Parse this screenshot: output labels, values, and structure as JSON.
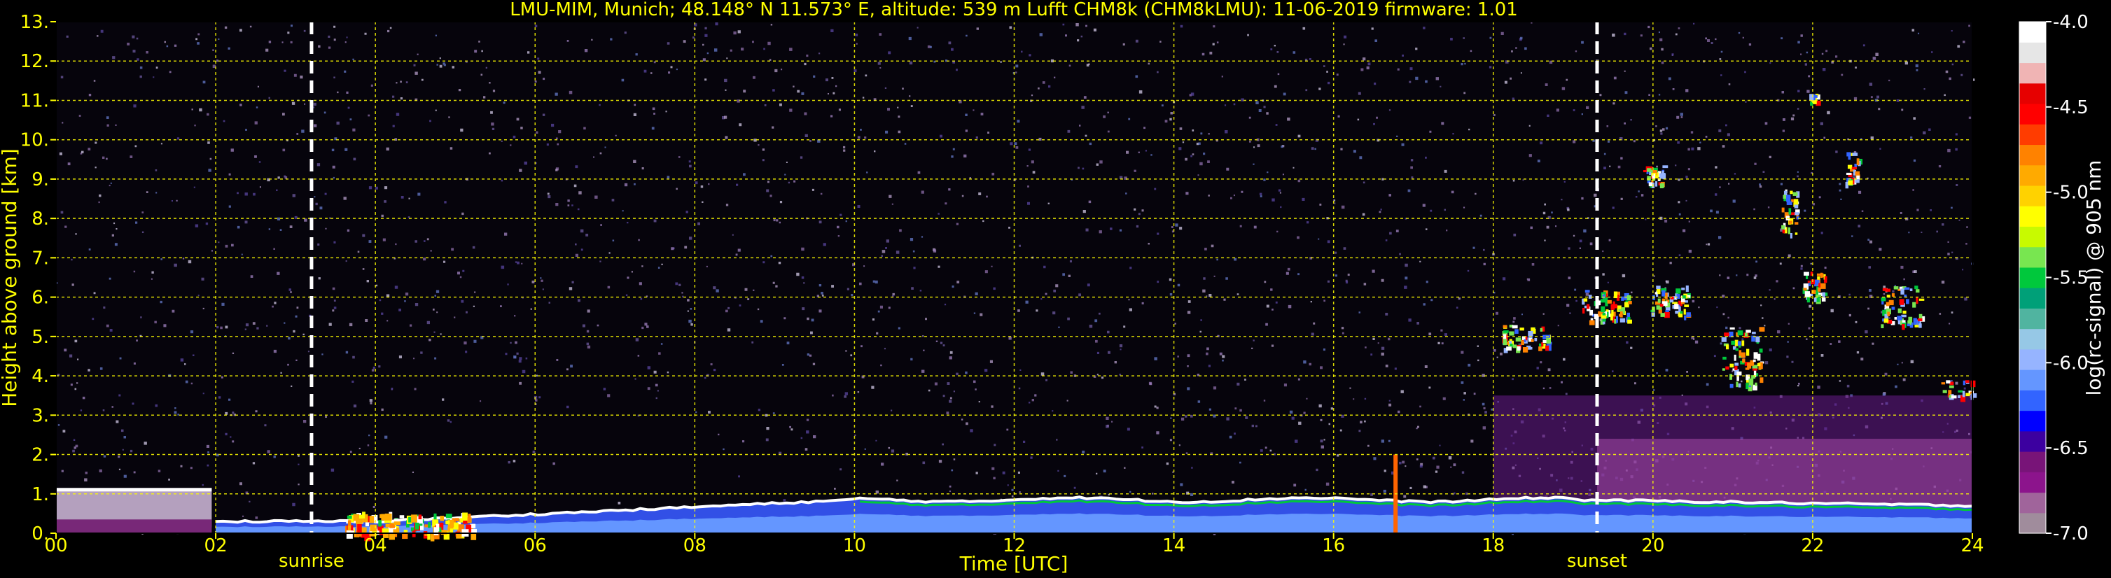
{
  "chart_data": {
    "type": "heatmap",
    "title": "LMU-MIM, Munich; 48.148° N 11.573° E, altitude: 539 m    Lufft CHM8k (CHM8kLMU): 11-06-2019    firmware: 1.01",
    "xlabel": "Time [UTC]",
    "ylabel": "Height above ground [km]",
    "colorbar_label": "log(rc-signal) @ 905 nm",
    "xlim": [
      0,
      24
    ],
    "ylim": [
      0,
      13
    ],
    "x_ticks": [
      "00",
      "02",
      "04",
      "06",
      "08",
      "10",
      "12",
      "14",
      "16",
      "18",
      "20",
      "22",
      "24"
    ],
    "y_ticks": [
      "0.",
      "1.",
      "2.",
      "3.",
      "4.",
      "5.",
      "6.",
      "7.",
      "8.",
      "9.",
      "10.",
      "11.",
      "12.",
      "13."
    ],
    "colorbar_ticks": [
      "-4.0",
      "-4.5",
      "-5.0",
      "-5.5",
      "-6.0",
      "-6.5",
      "-7.0"
    ],
    "colorbar_range": [
      -7.0,
      -4.0
    ],
    "grid": true,
    "annotations": [
      {
        "label": "sunrise",
        "time": 3.2
      },
      {
        "label": "sunset",
        "time": 19.3
      }
    ]
  },
  "colors": {
    "background": "#000000",
    "text": "#ffff00",
    "grid": "#ffff00",
    "marker_line": "#ffffff",
    "colormap": [
      "#a08c9c",
      "#a0649b",
      "#8c148c",
      "#781478",
      "#3c00a0",
      "#0000ff",
      "#3264ff",
      "#6496ff",
      "#96b4ff",
      "#96c8e6",
      "#50b4a0",
      "#00a078",
      "#00c83c",
      "#78e650",
      "#c8fa00",
      "#ffff00",
      "#ffd200",
      "#ffaa00",
      "#ff8200",
      "#ff3c00",
      "#ff0000",
      "#e60000",
      "#f0b4b4",
      "#e6e6e6",
      "#ffffff"
    ]
  }
}
